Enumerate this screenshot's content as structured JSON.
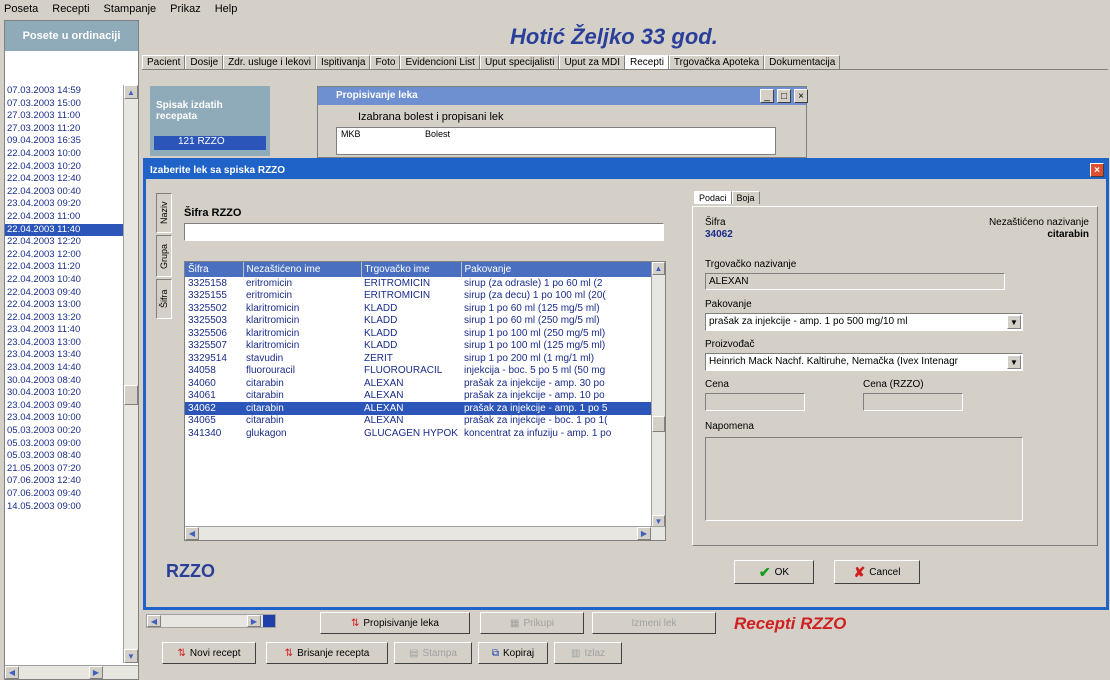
{
  "menubar": [
    "Posetа",
    "Recepti",
    "Stampanje",
    "Prikaz",
    "Help"
  ],
  "left_panel": {
    "header": "Posete u ordinaciji",
    "visits": [
      "07.03.2003 14:59",
      "07.03.2003 15:00",
      "27.03.2003 11:00",
      "27.03.2003 11:20",
      "09.04.2003 16:35",
      "22.04.2003 10:00",
      "22.04.2003 10:20",
      "22.04.2003 12:40",
      "22.04.2003 00:40",
      "23.04.2003 09:20",
      "22.04.2003 11:00",
      "22.04.2003 11:40",
      "22.04.2003 12:20",
      "22.04.2003 12:00",
      "22.04.2003 11:20",
      "22.04.2003 10:40",
      "22.04.2003 09:40",
      "22.04.2003 13:00",
      "22.04.2003 13:20",
      "23.04.2003 11:40",
      "23.04.2003 13:00",
      "23.04.2003 13:40",
      "23.04.2003 14:40",
      "30.04.2003 08:40",
      "30.04.2003 10:20",
      "23.04.2003 09:40",
      "23.04.2003 10:00",
      "05.03.2003 00:20",
      "05.03.2003 09:00",
      "05.03.2003 08:40",
      "21.05.2003 07:20",
      "07.06.2003 12:40",
      "07.06.2003 09:40",
      "14.05.2003 09:00"
    ],
    "selected_index": 11
  },
  "patient_title": "Hotić Željko 33 god.",
  "tabs": [
    "Pacient",
    "Dosije",
    "Zdr. usluge i lekovi",
    "Ispitivanja",
    "Foto",
    "Evidencioni List",
    "Uput specijalisti",
    "Uput za MDI",
    "Recepti",
    "Trgovačka Apoteka",
    "Dokumentacija"
  ],
  "active_tab": "Recepti",
  "recepti": {
    "spisak_label": "Spisak izdatih recepata",
    "first_recept": "121 RZZO",
    "propisivanje_title": "Propisivanje leka",
    "izabrana_label": "Izabrana bolest i propisani lek",
    "mkb_header": "MKB",
    "bolest_header": "Bolest"
  },
  "dialog": {
    "title": "Izaberite lek sa spiska RZZO",
    "side_tabs": [
      "Šifra",
      "Grupa",
      "Naziv"
    ],
    "sifra_label": "Šifra RZZO",
    "sifra_value": "",
    "columns": [
      "Šifra",
      "Nezaštićeno ime",
      "Trgovačko ime",
      "Pakovanje"
    ],
    "rows": [
      [
        "3325158",
        "eritromicin",
        "ERITROMICIN",
        "sirup (za odrasle) 1 po 60 ml (2"
      ],
      [
        "3325155",
        "eritromicin",
        "ERITROMICIN",
        "sirup (za decu) 1 po 100 ml (20("
      ],
      [
        "3325502",
        "klaritromicin",
        "KLADD",
        "sirup 1 po 60 ml (125 mg/5 ml)"
      ],
      [
        "3325503",
        "klaritromicin",
        "KLADD",
        "sirup 1 po 60 ml (250 mg/5 ml)"
      ],
      [
        "3325506",
        "klaritromicin",
        "KLADD",
        "sirup 1 po 100 ml (250 mg/5 ml)"
      ],
      [
        "3325507",
        "klaritromicin",
        "KLADD",
        "sirup 1 po 100 ml (125 mg/5 ml)"
      ],
      [
        "3329514",
        "stavudin",
        "ZERIT",
        "sirup 1 po 200 ml (1 mg/1 ml)"
      ],
      [
        "34058",
        "fluorouracil",
        "FLUOROURACIL",
        "injekcija - boc. 5 po 5 ml (50 mg"
      ],
      [
        "34060",
        "citarabin",
        "ALEXAN",
        "prašak za injekcije - amp. 30 po"
      ],
      [
        "34061",
        "citarabin",
        "ALEXAN",
        "prašak za injekcije - amp. 10 po"
      ],
      [
        "34062",
        "citarabin",
        "ALEXAN",
        "prašak za injekcije - amp. 1 po 5"
      ],
      [
        "34065",
        "citarabin",
        "ALEXAN",
        "prašak za injekcije - boc. 1 po 1("
      ],
      [
        "341340",
        "glukagon",
        "GLUCAGEN HYPOK",
        "koncentrat za infuziju - amp. 1 po"
      ]
    ],
    "selected_row": 10,
    "footer_label": "RZZO",
    "detail": {
      "tabs": [
        "Podaci",
        "Boja"
      ],
      "sifra_label": "Šifra",
      "sifra_value": "34062",
      "nezasticeno_label": "Nezaštićeno nazivanje",
      "nezasticeno_value": "citarabin",
      "trgovacko_label": "Trgovačko nazivanje",
      "trgovacko_value": "ALEXAN",
      "pakovanje_label": "Pakovanje",
      "pakovanje_value": "prašak za injekcije - amp. 1 po 500 mg/10 ml",
      "proizvodjac_label": "Proizvođač",
      "proizvodjac_value": "Heinrich Mack Nachf. Kaltiruhe, Nemačka (Ivex Intenagr",
      "cena_label": "Cena",
      "cena_rzzo_label": "Cena (RZZO)",
      "cena_value": "",
      "cena_rzzo_value": "",
      "napomena_label": "Napomena",
      "napomena_value": ""
    },
    "ok_label": "OK",
    "cancel_label": "Cancel"
  },
  "bottom": {
    "propisivanje_btn": "Propisivanje leka",
    "btn2": "Prikupi",
    "btn3": "Izmeni lek",
    "recepti_label": "Recepti RZZO",
    "novi_recept": "Novi recept",
    "brisanje_recepta": "Brisanje recepta",
    "stampa": "Stampa",
    "kopiraj": "Kopiraj",
    "izlaz": "Izlaz"
  },
  "colors": {
    "accent": "#1f62c8",
    "selection": "#2b55b8",
    "title": "#2a3f9a",
    "red": "#d02020"
  }
}
